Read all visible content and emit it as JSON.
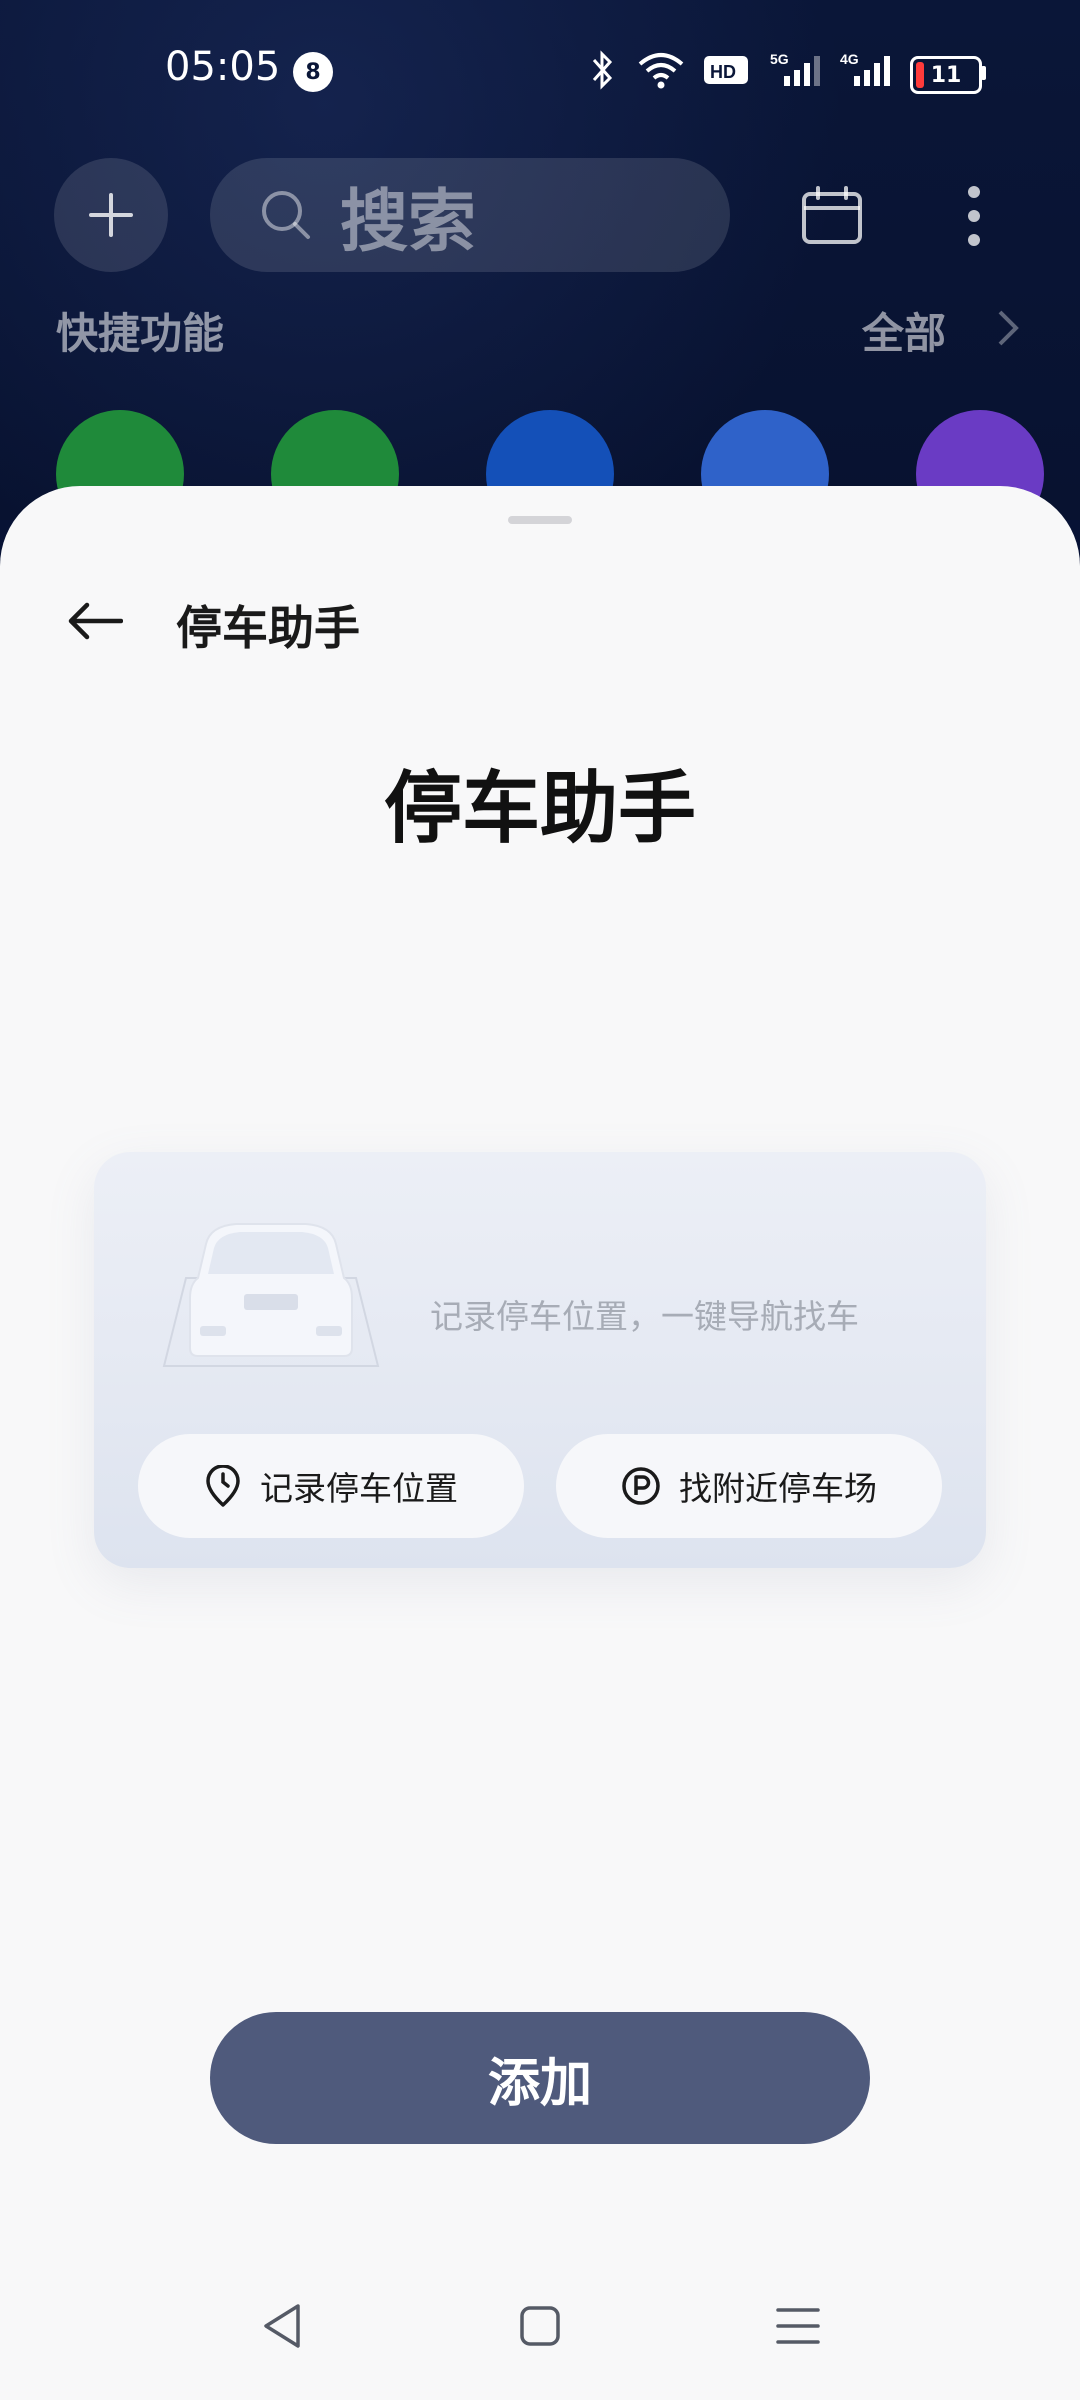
{
  "status_bar": {
    "time": "05:05",
    "notification_count": "8",
    "network_labels": {
      "hd": "HD",
      "5g": "5G",
      "4g": "4G"
    },
    "battery": "11"
  },
  "home": {
    "search_placeholder": "搜索",
    "quick_functions_title": "快捷功能",
    "all_label": "全部",
    "app_colors": [
      "#1f8a3a",
      "#1f8a3a",
      "#1450b8",
      "#2f62c9",
      "#6a3bc4"
    ]
  },
  "sheet": {
    "title": "停车助手",
    "heading": "停车助手",
    "widget": {
      "description": "记录停车位置，一键导航找车",
      "button_record": "记录停车位置",
      "button_find": "找附近停车场"
    },
    "add_button": "添加"
  },
  "colors": {
    "primary_button": "#4f5a7c",
    "background_dark": "#0a1638",
    "sheet_bg": "#f8f8f9"
  },
  "icons": [
    "plus-icon",
    "search-icon",
    "calendar-icon",
    "more-vertical-icon",
    "chevron-right-icon",
    "back-arrow-icon",
    "location-pin-icon",
    "parking-icon",
    "nav-back-icon",
    "nav-home-icon",
    "nav-menu-icon",
    "bluetooth-icon",
    "wifi-icon"
  ]
}
